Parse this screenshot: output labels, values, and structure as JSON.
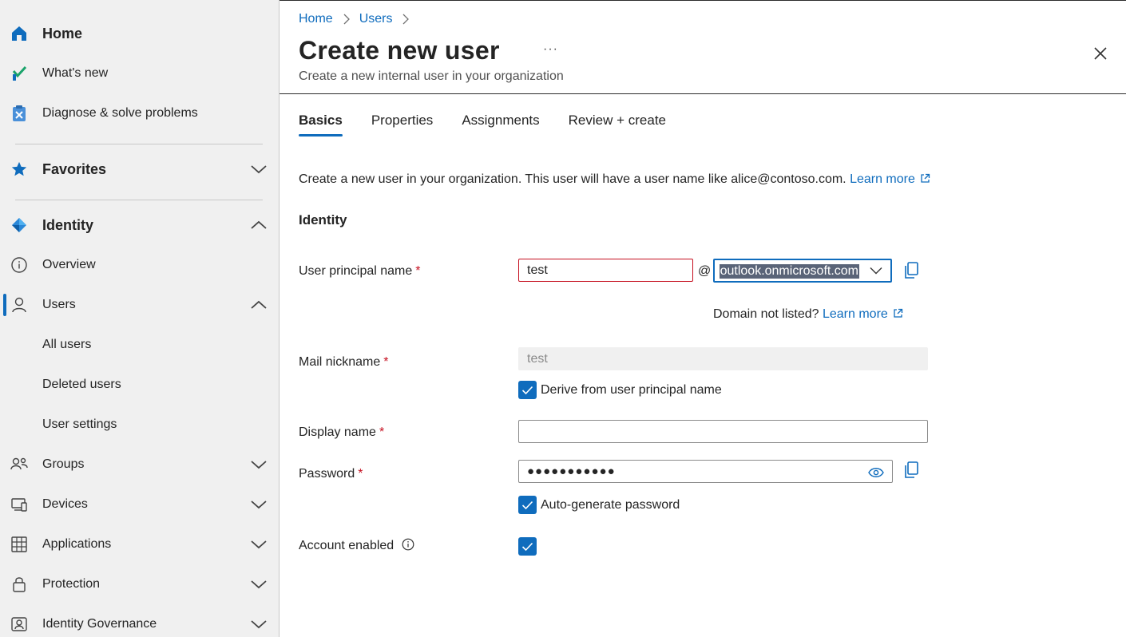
{
  "colors": {
    "accent": "#0f6cbd",
    "required": "#c50f1f",
    "sidebar_bg": "#f0f0f0"
  },
  "sidebar": {
    "top_items": [
      {
        "label": "Home",
        "icon": "home-icon"
      },
      {
        "label": "What's new",
        "icon": "whats-new-icon"
      },
      {
        "label": "Diagnose & solve problems",
        "icon": "diagnose-icon"
      }
    ],
    "favorites": {
      "label": "Favorites",
      "icon": "star-icon",
      "expanded": false
    },
    "identity": {
      "label": "Identity",
      "icon": "identity-diamond-icon",
      "expanded": true
    },
    "identity_items": {
      "overview": "Overview",
      "users": "Users",
      "all_users": "All users",
      "deleted_users": "Deleted users",
      "user_settings": "User settings",
      "groups": "Groups",
      "devices": "Devices",
      "applications": "Applications",
      "protection": "Protection",
      "identity_governance": "Identity Governance"
    }
  },
  "breadcrumb": {
    "home": "Home",
    "users": "Users"
  },
  "header": {
    "title": "Create new user",
    "more": "···",
    "subtitle": "Create a new internal user in your organization"
  },
  "tabs": [
    "Basics",
    "Properties",
    "Assignments",
    "Review + create"
  ],
  "active_tab": "Basics",
  "intro": {
    "text": "Create a new user in your organization. This user will have a user name like alice@contoso.com.",
    "link": "Learn more"
  },
  "section_title": "Identity",
  "form": {
    "upn": {
      "label": "User principal name",
      "required": "*",
      "value": "test",
      "at": "@",
      "domain": "outlook.onmicrosoft.com"
    },
    "domain_note": {
      "text": "Domain not listed?",
      "link": "Learn more"
    },
    "mail_nickname": {
      "label": "Mail nickname",
      "required": "*",
      "value": "test"
    },
    "derive_checkbox": {
      "label": "Derive from user principal name",
      "checked": true
    },
    "display_name": {
      "label": "Display name",
      "required": "*",
      "value": ""
    },
    "password": {
      "label": "Password",
      "required": "*",
      "masked": "●●●●●●●●●●●"
    },
    "autogen_checkbox": {
      "label": "Auto-generate password",
      "checked": true
    },
    "account_enabled": {
      "label": "Account enabled",
      "checked": true
    }
  }
}
